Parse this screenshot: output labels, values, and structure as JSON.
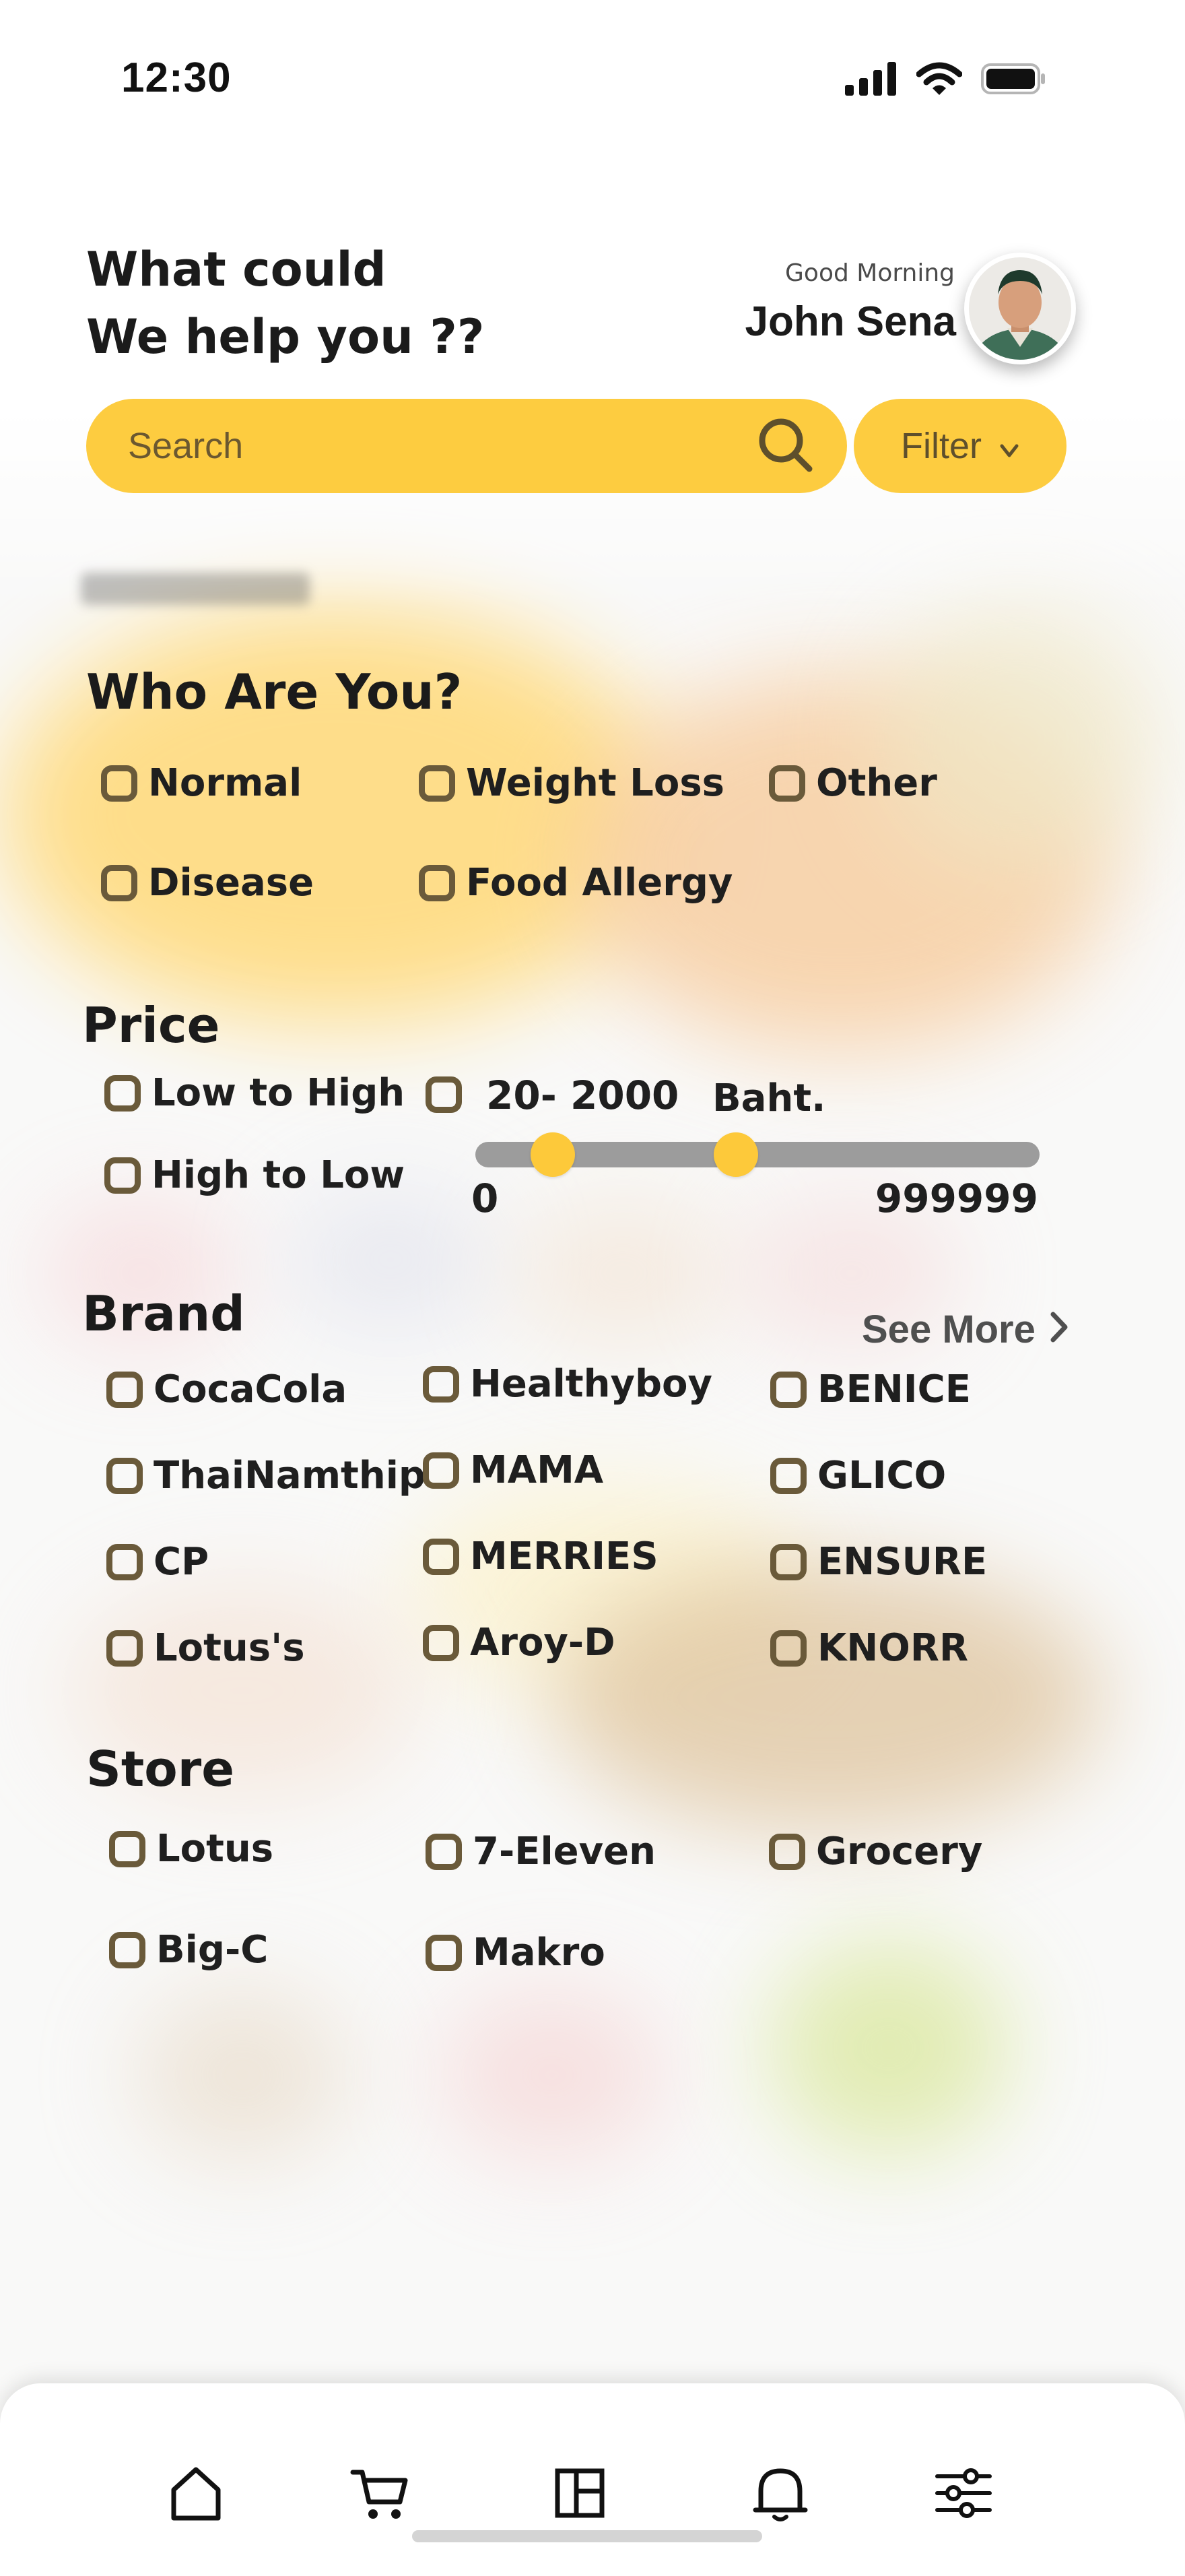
{
  "status_bar": {
    "time": "12:30",
    "icons": [
      "signal-icon",
      "wifi-icon",
      "battery-icon"
    ]
  },
  "header": {
    "headline_line1": "What could",
    "headline_line2": "We help you ??",
    "greeting": "Good Morning",
    "username": "John Sena"
  },
  "search": {
    "placeholder": "Search",
    "value": ""
  },
  "filter_button": {
    "label": "Filter",
    "icon": "chevron-down-icon"
  },
  "who_are_you": {
    "title": "Who Are You?",
    "options": [
      "Normal",
      "Weight Loss",
      "Other",
      "Disease",
      "Food Allergy"
    ]
  },
  "price": {
    "title": "Price",
    "sort_options": [
      "Low to High",
      "High to Low"
    ],
    "range_label": "20- 2000",
    "unit": "Baht.",
    "slider_min": "0",
    "slider_max": "999999"
  },
  "brand": {
    "title": "Brand",
    "see_more": "See More",
    "options": [
      "CocaCola",
      "Healthyboy",
      "BENICE",
      "ThaiNamthip",
      "MAMA",
      "GLICO",
      "CP",
      "MERRIES",
      "ENSURE",
      "Lotus's",
      "Aroy-D",
      "KNORR"
    ]
  },
  "store": {
    "title": "Store",
    "options": [
      "Lotus",
      "7-Eleven",
      "Grocery",
      "Big-C",
      "Makro"
    ]
  },
  "bottom_nav": {
    "items": [
      "home-icon",
      "cart-icon",
      "layout-icon",
      "bell-icon",
      "sliders-icon"
    ]
  },
  "colors": {
    "accent": "#FDCC40",
    "checkbox_border": "#6A5A3A",
    "slider_track": "#9C9C9C",
    "text": "#1B1B1B"
  }
}
